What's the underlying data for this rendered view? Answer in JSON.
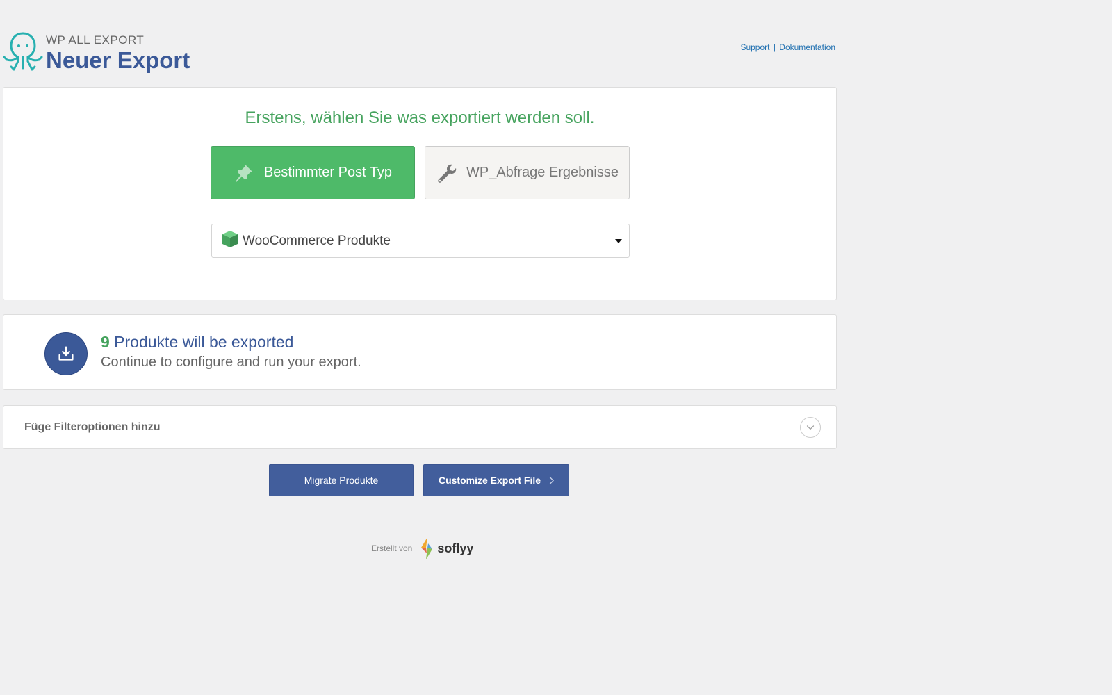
{
  "header": {
    "brand_small": "WP ALL EXPORT",
    "title": "Neuer Export",
    "links": {
      "support": "Support",
      "separator": "|",
      "docs": "Dokumentation"
    }
  },
  "choose": {
    "heading": "Erstens, wählen Sie was exportiert werden soll.",
    "type_buttons": [
      {
        "label": "Bestimmter Post Typ",
        "icon": "pin-icon",
        "active": true
      },
      {
        "label": "WP_Abfrage Ergebnisse",
        "icon": "wrench-icon",
        "active": false
      }
    ],
    "post_type_select": {
      "selected": "WooCommerce Produkte",
      "icon": "box-icon"
    }
  },
  "summary": {
    "count": "9",
    "count_text": " Produkte will be exported",
    "subtext": "Continue to configure and run your export."
  },
  "filter": {
    "label": "Füge Filteroptionen hinzu"
  },
  "actions": {
    "migrate": "Migrate Produkte",
    "customize": "Customize Export File"
  },
  "footer": {
    "created_by": "Erstellt von",
    "brand": "soflyy"
  },
  "colors": {
    "primary_blue": "#3b5998",
    "button_blue": "#425e9c",
    "green": "#4eba69",
    "heading_green": "#46a35e",
    "teal": "#27b0b0"
  }
}
